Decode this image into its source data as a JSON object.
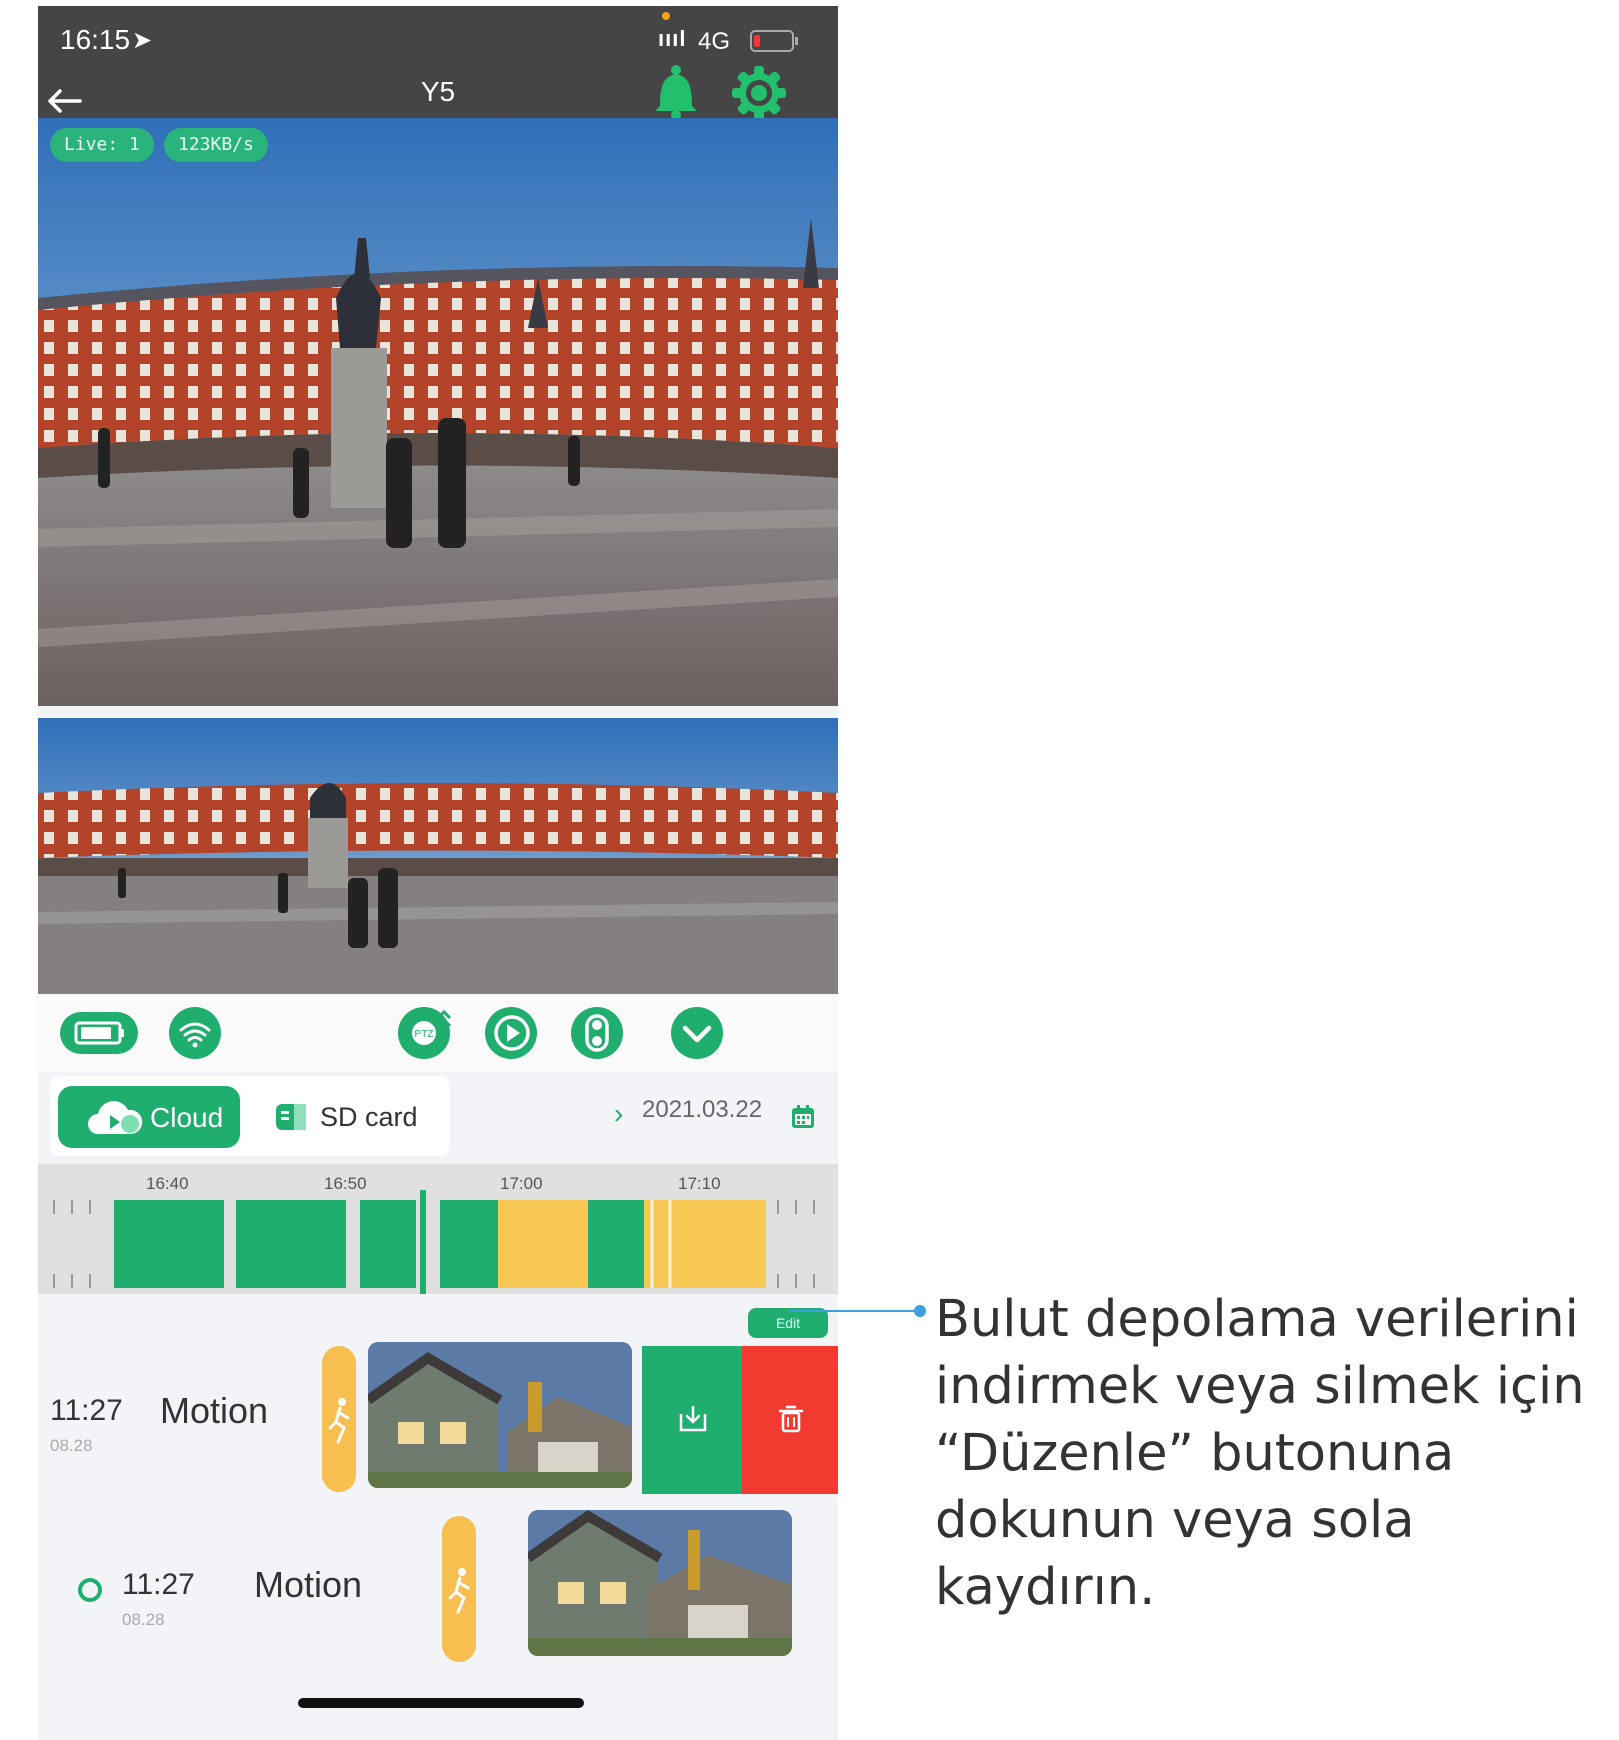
{
  "status_bar": {
    "time": "16:15",
    "network": "4G",
    "signal_glyph": "ıııl"
  },
  "header": {
    "title": "Y5"
  },
  "video": {
    "live_badge": "Live: 1",
    "speed_badge": "123KB/s"
  },
  "tabs": {
    "cloud_label": "Cloud",
    "sd_label": "SD card",
    "date": "2021.03.22"
  },
  "timeline": {
    "labels": [
      "16:40",
      "16:50",
      "17:00",
      "17:10"
    ]
  },
  "edit": {
    "label": "Edit"
  },
  "events": [
    {
      "time": "11:27",
      "date": "08.28",
      "type": "Motion"
    },
    {
      "time": "11:27",
      "date": "08.28",
      "type": "Motion"
    }
  ],
  "callout": {
    "text": "Bulut depolama verilerini indirmek veya silmek için “Düzenle” butonuna dokunun veya sola kaydırın."
  },
  "colors": {
    "accent": "#1fae6e",
    "warning": "#f7bf50",
    "delete": "#f23b30",
    "header_bg": "#454545"
  }
}
